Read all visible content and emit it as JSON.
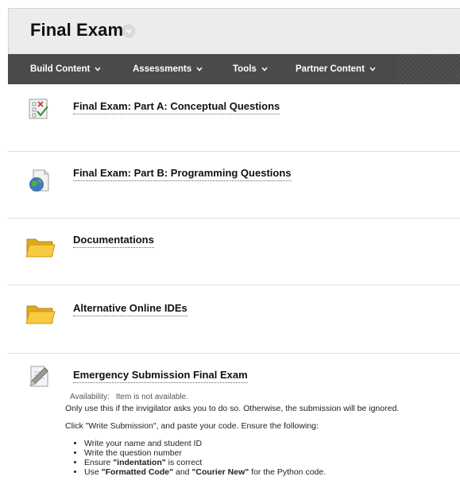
{
  "header": {
    "title": "Final Exam"
  },
  "actionbar": {
    "items": [
      {
        "label": "Build Content"
      },
      {
        "label": "Assessments"
      },
      {
        "label": "Tools"
      },
      {
        "label": "Partner Content"
      }
    ]
  },
  "items": [
    {
      "title": "Final Exam: Part A: Conceptual Questions",
      "icon": "test-icon"
    },
    {
      "title": "Final Exam: Part B: Programming Questions",
      "icon": "web-link-icon"
    },
    {
      "title": "Documentations",
      "icon": "folder-icon"
    },
    {
      "title": "Alternative Online IDEs",
      "icon": "folder-icon"
    },
    {
      "title": "Emergency Submission Final Exam",
      "icon": "assignment-icon"
    }
  ],
  "emergency": {
    "availability_label": "Availability:",
    "availability_value": "Item is not available.",
    "line1": "Only use this if the invigilator asks you to do so. Otherwise, the submission will be ignored.",
    "line2": "Click \"Write Submission\", and paste your code. Ensure the following:",
    "bullets": [
      "Write your name and student ID",
      "Write the question number"
    ],
    "bullet3_prefix": "Ensure ",
    "bullet3_bold": "\"indentation\"",
    "bullet3_suffix": " is correct",
    "bullet4_prefix": "Use ",
    "bullet4_bold1": "\"Formatted Code\"",
    "bullet4_mid": " and ",
    "bullet4_bold2": "\"Courier New\"",
    "bullet4_suffix": " for the Python code."
  },
  "colors": {
    "actionbar_bg": "#4a4a4a",
    "header_bg": "#ececec",
    "folder": "#f2c12e"
  }
}
